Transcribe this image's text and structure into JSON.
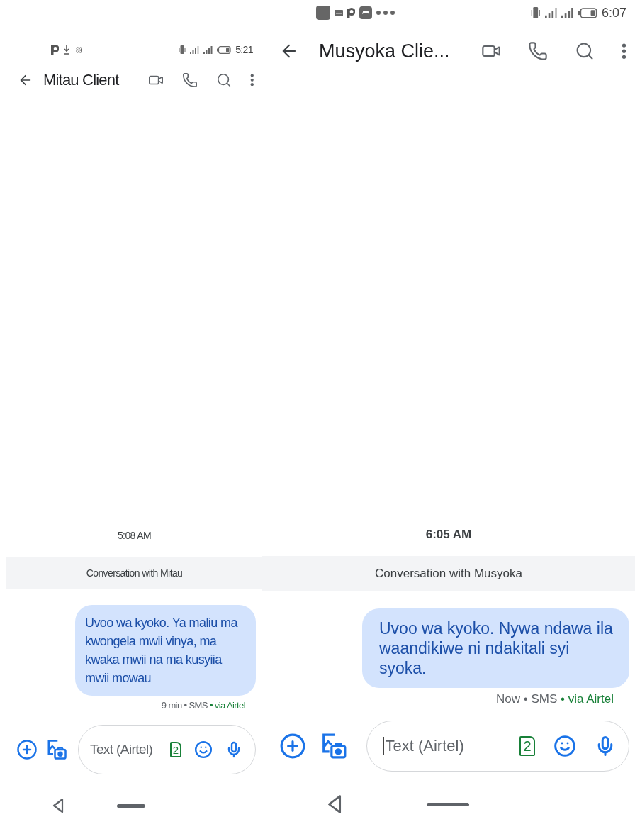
{
  "phones": [
    {
      "status_bar": {
        "icons": [
          {
            "kind": "p-logo"
          },
          {
            "kind": "download"
          },
          {
            "kind": "pinwheel"
          }
        ],
        "time": "5:21"
      },
      "header": {
        "title": "Mitau Client"
      },
      "timestamp": "5:08 AM",
      "banner": "Conversation with Mitau",
      "messages": [
        {
          "text": "Uvoo wa kyoko. Ya maliu ma kwongela mwii vinya, ma kwaka mwii na ma kusyiia mwii mowau",
          "meta": "9 min • SMS",
          "via": " • via Airtel"
        }
      ],
      "compose": {
        "placeholder": "Text (Airtel)",
        "sim": "2",
        "focused": false
      }
    },
    {
      "status_bar": {
        "icons": [
          {
            "kind": "square"
          },
          {
            "kind": "message"
          },
          {
            "kind": "p-logo"
          },
          {
            "kind": "gamepad"
          },
          {
            "kind": "dots"
          }
        ],
        "time": "6:07"
      },
      "header": {
        "title": "Musyoka Clie..."
      },
      "timestamp": "6:05 AM",
      "banner": "Conversation with Musyoka",
      "messages": [
        {
          "text": "Uvoo wa kyoko. Nywa ndawa ila waandikiwe ni ndakitali syi syoka.",
          "meta": "Now • SMS",
          "via": " • via Airtel"
        }
      ],
      "compose": {
        "placeholder": "Text (Airtel)",
        "sim": "2",
        "focused": true
      }
    }
  ]
}
